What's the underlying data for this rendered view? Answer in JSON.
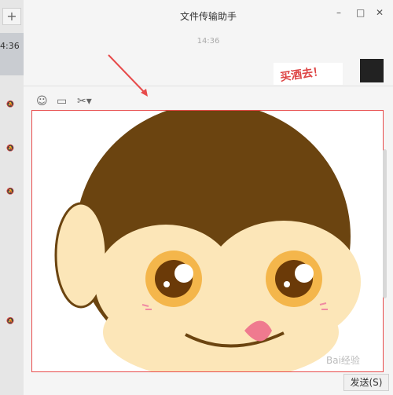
{
  "sidebar": {
    "add_label": "+",
    "selected_time": "4:36",
    "ghost_icons": [
      "mute-icon",
      "mute-icon",
      "mute-icon",
      "mute-icon"
    ]
  },
  "window": {
    "title": "文件传输助手"
  },
  "chat": {
    "timestamp": "14:36",
    "sticker_text": "买酒去！"
  },
  "toolbar": {
    "icons": [
      "emoji-icon",
      "folder-icon",
      "scissors-icon"
    ]
  },
  "editor": {
    "content": "monkey-sticker-image"
  },
  "actions": {
    "send_label": "发送(S)"
  },
  "watermark": {
    "text": "Bai经验"
  }
}
